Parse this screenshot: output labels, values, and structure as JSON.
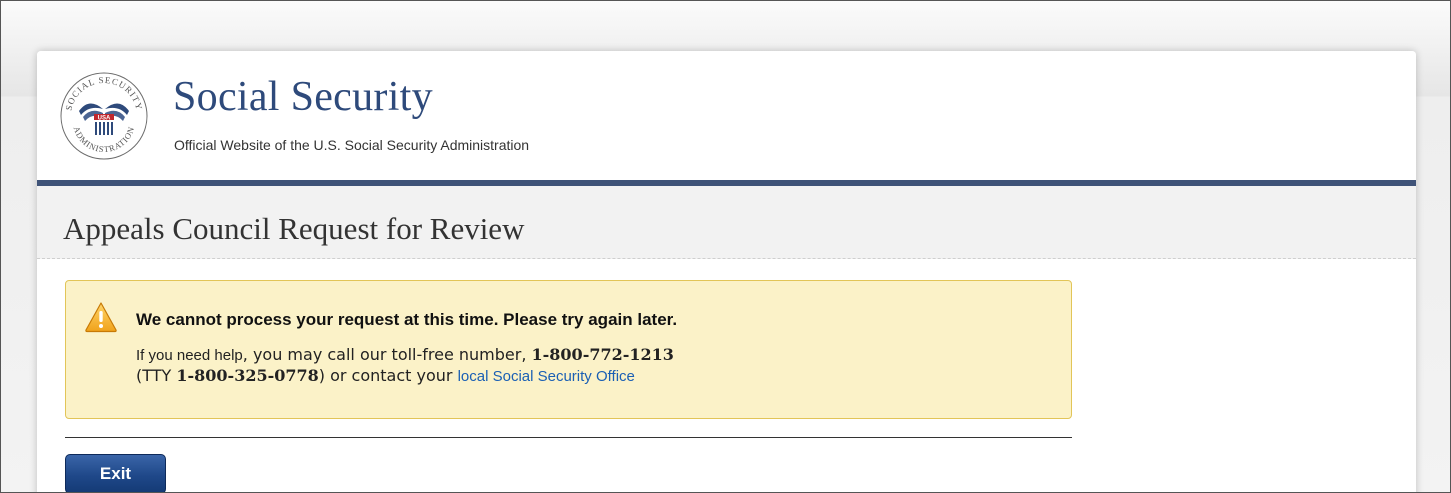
{
  "header": {
    "seal_text_top": "SOCIAL SECURITY",
    "seal_text_bottom": "ADMINISTRATION",
    "seal_text_center": "USA",
    "site_title": "Social Security",
    "site_subtitle": "Official Website of the U.S. Social Security Administration"
  },
  "page": {
    "title": "Appeals Council Request for Review"
  },
  "alert": {
    "icon": "warning-triangle-icon",
    "heading": "We cannot process your request at this time. Please try again later.",
    "line1_prefix": "If you need help",
    "line1_mid": ", you may call our toll-free number, ",
    "phone": "1-800-772-1213",
    "line2_open": "(TTY ",
    "tty": "1-800-325-0778",
    "line2_mid": ") or contact your ",
    "link_text": "local Social Security Office"
  },
  "actions": {
    "exit_label": "Exit"
  },
  "colors": {
    "brand_blue": "#2e4a7b",
    "rule_blue": "#3f5378",
    "alert_bg": "#fbf2c8",
    "alert_border": "#e2c558",
    "link": "#1a5fb4",
    "button": "#1f4889"
  }
}
